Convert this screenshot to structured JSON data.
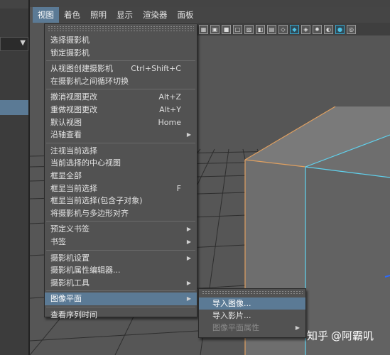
{
  "menubar": {
    "items": [
      {
        "label": "视图",
        "active": true
      },
      {
        "label": "着色",
        "active": false
      },
      {
        "label": "照明",
        "active": false
      },
      {
        "label": "显示",
        "active": false
      },
      {
        "label": "渲染器",
        "active": false
      },
      {
        "label": "面板",
        "active": false
      }
    ]
  },
  "toolbar": {
    "icons": [
      "wireframe-toggle-icon",
      "smooth-shade-icon",
      "default-material-icon",
      "bounding-box-icon",
      "xray-icon",
      "isolate-select-icon",
      "resolution-gate-icon",
      "wireframe-cube-icon",
      "shaded-cube-icon",
      "textured-icon",
      "lighting-icon",
      "shadow-icon",
      "ambient-occlusion-icon",
      "motion-blur-icon"
    ]
  },
  "view_menu": {
    "groups": [
      [
        {
          "label": "选择摄影机",
          "shortcut": "",
          "submenu": false
        },
        {
          "label": "锁定摄影机",
          "shortcut": "",
          "submenu": false
        }
      ],
      [
        {
          "label": "从视图创建摄影机",
          "shortcut": "Ctrl+Shift+C",
          "submenu": false
        },
        {
          "label": "在摄影机之间循环切换",
          "shortcut": "",
          "submenu": false
        }
      ],
      [
        {
          "label": "撤消视图更改",
          "shortcut": "Alt+Z",
          "submenu": false
        },
        {
          "label": "重做视图更改",
          "shortcut": "Alt+Y",
          "submenu": false
        },
        {
          "label": "默认视图",
          "shortcut": "Home",
          "submenu": false
        },
        {
          "label": "沿轴查看",
          "shortcut": "",
          "submenu": true
        }
      ],
      [
        {
          "label": "注视当前选择",
          "shortcut": "",
          "submenu": false
        },
        {
          "label": "当前选择的中心视图",
          "shortcut": "",
          "submenu": false
        },
        {
          "label": "框显全部",
          "shortcut": "",
          "submenu": false
        },
        {
          "label": "框显当前选择",
          "shortcut": "F",
          "submenu": false
        },
        {
          "label": "框显当前选择(包含子对象)",
          "shortcut": "",
          "submenu": false
        },
        {
          "label": "将摄影机与多边形对齐",
          "shortcut": "",
          "submenu": false
        }
      ],
      [
        {
          "label": "预定义书签",
          "shortcut": "",
          "submenu": true
        },
        {
          "label": "书签",
          "shortcut": "",
          "submenu": true
        }
      ],
      [
        {
          "label": "摄影机设置",
          "shortcut": "",
          "submenu": true
        },
        {
          "label": "摄影机属性编辑器...",
          "shortcut": "",
          "submenu": false
        },
        {
          "label": "摄影机工具",
          "shortcut": "",
          "submenu": true
        }
      ],
      [
        {
          "label": "图像平面",
          "shortcut": "",
          "submenu": true,
          "highlighted": true
        }
      ],
      [
        {
          "label": "查看序列时间",
          "shortcut": "",
          "submenu": false
        }
      ]
    ]
  },
  "image_plane_menu": {
    "items": [
      {
        "label": "导入图像...",
        "highlighted": true,
        "disabled": false,
        "submenu": false
      },
      {
        "label": "导入影片...",
        "highlighted": false,
        "disabled": false,
        "submenu": false
      },
      {
        "label": "图像平面属性",
        "highlighted": false,
        "disabled": true,
        "submenu": true
      }
    ]
  },
  "watermark": {
    "site": "知乎",
    "author": "@阿霸叽"
  },
  "colors": {
    "highlight": "#5b7a95",
    "menu_bg": "#525252",
    "wire_cyan": "#5fd3f0",
    "wire_orange": "#e0a060"
  }
}
